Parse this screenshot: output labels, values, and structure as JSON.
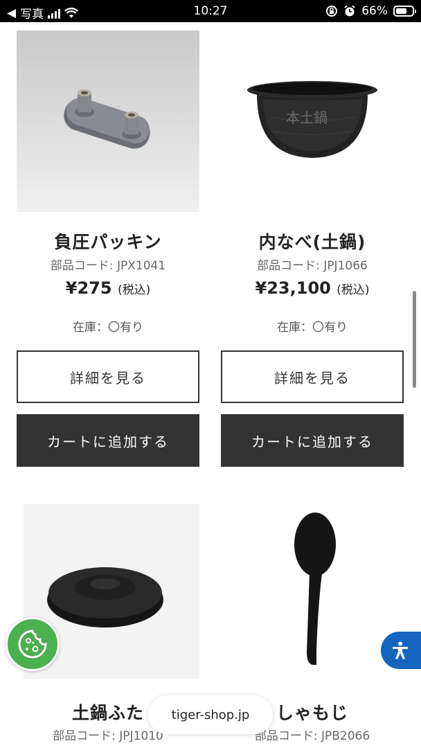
{
  "status_bar": {
    "back_app": "写真",
    "time": "10:27",
    "battery": "66%",
    "battery_level": 0.66,
    "icons": [
      "back-arrow-icon",
      "signal-icon",
      "wifi-icon",
      "orientation-lock-icon",
      "alarm-icon",
      "battery-icon"
    ]
  },
  "products": [
    {
      "name": "負圧パッキン",
      "code": "部品コード: JPX1041",
      "price": "¥275",
      "tax": "(税込)",
      "stock": "在庫：〇有り",
      "detail_label": "詳細を見る",
      "cart_label": "カートに追加する"
    },
    {
      "name": "内なべ(土鍋)",
      "code": "部品コード: JPJ1066",
      "price": "¥23,100",
      "tax": "(税込)",
      "stock": "在庫：〇有り",
      "detail_label": "詳細を見る",
      "cart_label": "カートに追加する",
      "image_text": "本土鍋"
    },
    {
      "name": "土鍋ふた",
      "code": "部品コード: JPJ1010"
    },
    {
      "name": "しゃもじ",
      "code": "部品コード: JPB2066"
    }
  ],
  "floating": {
    "url": "tiger-shop.jp",
    "cookie_icon": "cookie-icon",
    "accessibility_icon": "accessibility-icon"
  }
}
